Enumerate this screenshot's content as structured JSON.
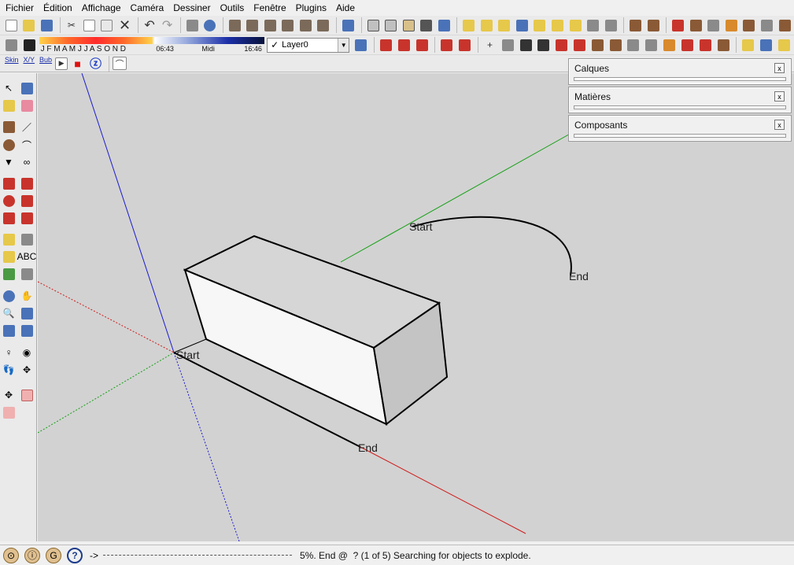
{
  "menu": [
    "Fichier",
    "Édition",
    "Affichage",
    "Caméra",
    "Dessiner",
    "Outils",
    "Fenêtre",
    "Plugins",
    "Aide"
  ],
  "shadow": {
    "months_label": "J F M A M J J A S O N D",
    "time_start": "06:43",
    "time_mid": "Midi",
    "time_end": "16:46"
  },
  "layer": {
    "check": "✓",
    "name": "Layer0"
  },
  "toolbar3": {
    "skin": "Skin",
    "xy": "X/Y",
    "bub": "Bub",
    "play": "▶",
    "stop": "■"
  },
  "tray": [
    {
      "title": "Calques",
      "close": "x"
    },
    {
      "title": "Matières",
      "close": "x"
    },
    {
      "title": "Composants",
      "close": "x"
    }
  ],
  "viewport_labels": {
    "arc_start": "Start",
    "arc_end": "End",
    "line_start": "Start",
    "line_end": "End"
  },
  "status": {
    "help_icon": "?",
    "prompt": "->",
    "message": "5%. End @  ? (1 of 5) Searching for objects to explode."
  },
  "colors": {
    "axis_red": "#d11a1a",
    "axis_green": "#12a012",
    "axis_blue": "#1a1ad0",
    "viewport_bg": "#d2d2d2"
  }
}
